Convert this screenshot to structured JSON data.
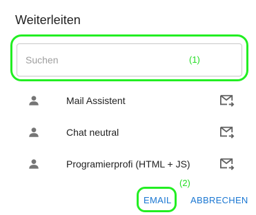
{
  "dialog": {
    "title": "Weiterleiten"
  },
  "search": {
    "placeholder": "Suchen",
    "value": ""
  },
  "annotations": {
    "search_label": "(1)",
    "email_label": "(2)",
    "color": "#22ee22"
  },
  "contacts": [
    {
      "name": "Mail Assistent",
      "icon": "person-icon",
      "action_icon": "forward-email-icon"
    },
    {
      "name": "Chat neutral",
      "icon": "person-icon",
      "action_icon": "forward-email-icon"
    },
    {
      "name": "Programierprofi (HTML + JS)",
      "icon": "person-icon",
      "action_icon": "forward-email-icon"
    }
  ],
  "actions": {
    "email_label": "EMAIL",
    "cancel_label": "ABBRECHEN",
    "accent_color": "#1976d2"
  }
}
